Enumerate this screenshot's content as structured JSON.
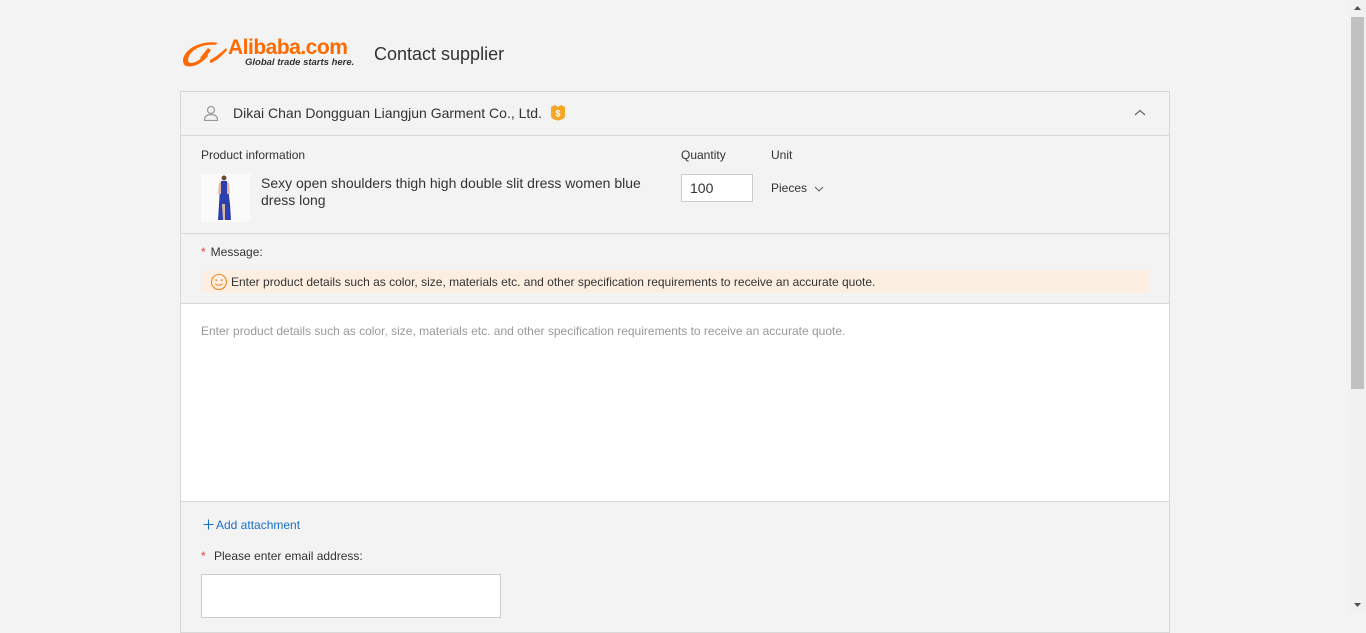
{
  "header": {
    "logo_word": "Alibaba.com",
    "logo_tagline": "Global trade starts here.",
    "page_title": "Contact supplier"
  },
  "supplier": {
    "name": "Dikai Chan Dongguan Liangjun Garment Co., Ltd.",
    "badge_icon": "gold-supplier-icon",
    "collapse_icon": "chevron-up-icon"
  },
  "product": {
    "section_label": "Product information",
    "name": "Sexy open shoulders thigh high double slit dress women blue dress long",
    "quantity_label": "Quantity",
    "quantity_value": "100",
    "unit_label": "Unit",
    "unit_value": "Pieces"
  },
  "message": {
    "required_mark": "*",
    "label": "Message:",
    "tip": "Enter product details such as color, size, materials etc. and other specification requirements to receive an accurate quote.",
    "placeholder": "Enter product details such as color, size, materials etc. and other specification requirements to receive an accurate quote."
  },
  "attachment": {
    "label": "Add attachment"
  },
  "email": {
    "required_mark": "*",
    "label": "Please enter email address:",
    "value": ""
  },
  "colors": {
    "brand": "#ff6a00",
    "link": "#1a6fc9",
    "required": "#e4393c",
    "tip_bg": "#fdeee2"
  }
}
